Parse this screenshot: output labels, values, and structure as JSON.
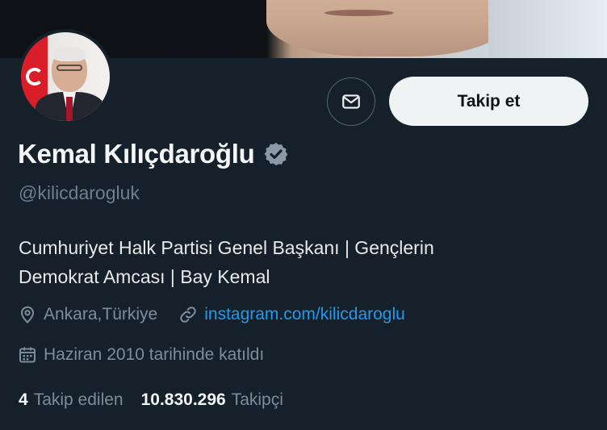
{
  "profile": {
    "name": "Kemal Kılıçdaroğlu",
    "handle": "@kilicdarogluk",
    "bio": "Cumhuriyet Halk Partisi Genel Başkanı | Gençlerin\nDemokrat Amcası | Bay Kemal",
    "location": "Ankara,Türkiye",
    "website": "instagram.com/kilicdaroglu",
    "joined": "Haziran 2010 tarihinde katıldı",
    "verified_icon": "verified-badge-icon"
  },
  "actions": {
    "message_icon": "envelope-icon",
    "follow_label": "Takip et"
  },
  "stats": {
    "following_count": "4",
    "following_label": "Takip edilen",
    "followers_count": "10.830.296",
    "followers_label": "Takipçi"
  },
  "colors": {
    "background": "#15202b",
    "link": "#1d9bf0",
    "muted": "#7d8d99",
    "button_bg": "#eff3f4",
    "verified": "#8b98a5"
  }
}
